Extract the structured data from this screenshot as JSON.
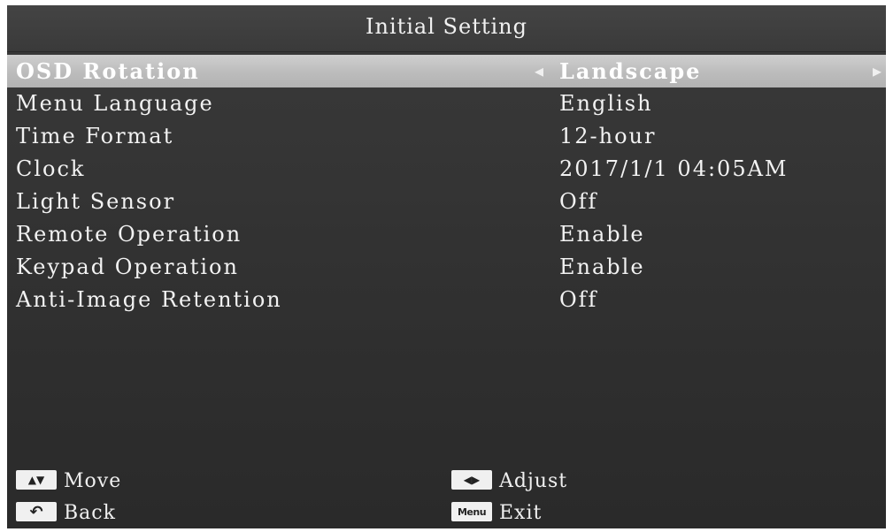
{
  "header": {
    "title": "Initial Setting"
  },
  "menu": {
    "items": [
      {
        "label": "OSD Rotation",
        "value": "Landscape"
      },
      {
        "label": "Menu Language",
        "value": "English"
      },
      {
        "label": "Time Format",
        "value": "12-hour"
      },
      {
        "label": "Clock",
        "value": "2017/1/1 04:05AM"
      },
      {
        "label": "Light Sensor",
        "value": "Off"
      },
      {
        "label": "Remote Operation",
        "value": "Enable"
      },
      {
        "label": "Keypad Operation",
        "value": "Enable"
      },
      {
        "label": "Anti-Image Retention",
        "value": "Off"
      }
    ]
  },
  "footer": {
    "move_label": "Move",
    "adjust_label": "Adjust",
    "back_label": "Back",
    "exit_label": "Exit",
    "menu_key_label": "Menu"
  }
}
